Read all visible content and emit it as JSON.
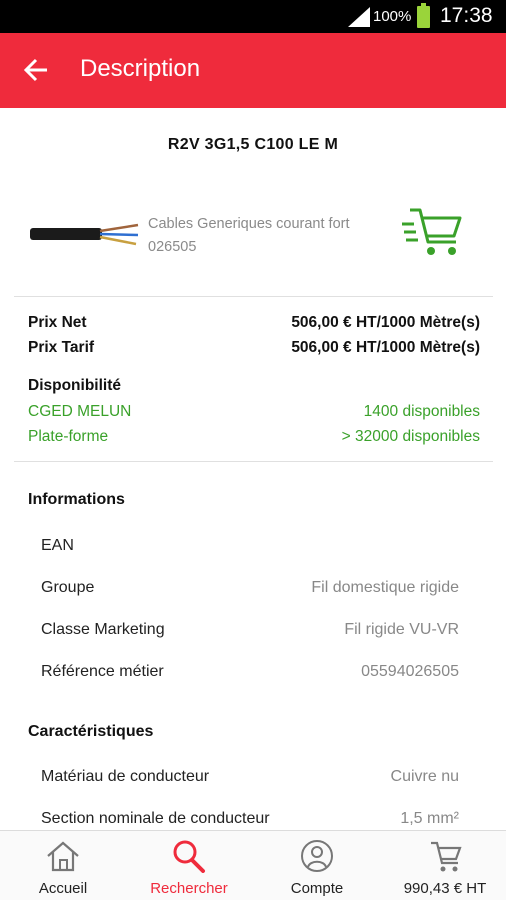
{
  "statusbar": {
    "battery": "100%",
    "time": "17:38"
  },
  "appbar": {
    "title": "Description",
    "back_icon": "arrow-back-icon"
  },
  "product": {
    "reference": "R2V 3G1,5 C100 LE M",
    "category": "Cables Generiques courant fort",
    "code": "026505",
    "add_to_cart_icon": "cart-add-icon"
  },
  "pricing": {
    "net_label": "Prix Net",
    "net_value": "506,00 € HT/1000 Mètre(s)",
    "tarif_label": "Prix Tarif",
    "tarif_value": "506,00 € HT/1000 Mètre(s)"
  },
  "availability": {
    "title": "Disponibilité",
    "rows": [
      {
        "location": "CGED MELUN",
        "value": "1400 disponibles"
      },
      {
        "location": "Plate-forme",
        "value": "> 32000 disponibles"
      }
    ]
  },
  "informations": {
    "title": "Informations",
    "rows": [
      {
        "label": "EAN",
        "value": ""
      },
      {
        "label": "Groupe",
        "value": "Fil domestique rigide"
      },
      {
        "label": "Classe Marketing",
        "value": "Fil rigide VU-VR"
      },
      {
        "label": "Référence métier",
        "value": "05594026505"
      }
    ]
  },
  "caracteristiques": {
    "title": "Caractéristiques",
    "rows": [
      {
        "label": "Matériau de conducteur",
        "value": "Cuivre nu"
      },
      {
        "label": "Section nominale de conducteur",
        "value": "1,5 mm²"
      }
    ]
  },
  "bottom_nav": {
    "items": [
      {
        "label": "Accueil",
        "icon": "home-icon"
      },
      {
        "label": "Rechercher",
        "icon": "search-icon",
        "active": true
      },
      {
        "label": "Compte",
        "icon": "account-icon"
      },
      {
        "label": "990,43 € HT",
        "icon": "cart-icon"
      }
    ]
  },
  "colors": {
    "brand": "#ef2b3c",
    "available": "#3aa12a"
  }
}
